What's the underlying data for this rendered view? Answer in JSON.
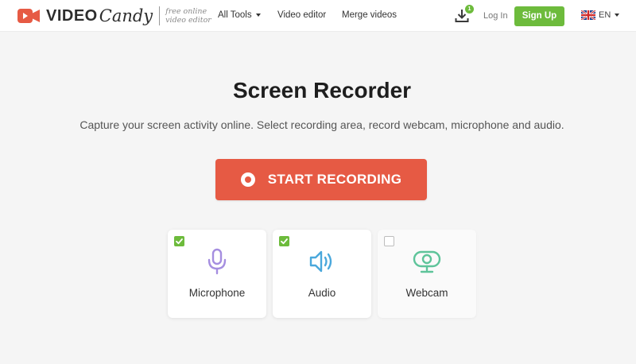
{
  "header": {
    "logo": {
      "word1": "VIDEO",
      "word2": "Candy",
      "tagline_line1": "free online",
      "tagline_line2": "video editor"
    },
    "nav": [
      {
        "label": "All Tools"
      },
      {
        "label": "Video editor"
      },
      {
        "label": "Merge videos"
      }
    ],
    "downloads_badge": "1",
    "login_label": "Log In",
    "signup_label": "Sign Up",
    "language": "EN"
  },
  "main": {
    "title": "Screen Recorder",
    "subtitle": "Capture your screen activity online. Select recording area, record webcam, microphone and audio.",
    "start_button": "START RECORDING"
  },
  "options": [
    {
      "label": "Microphone",
      "checked": true,
      "icon": "microphone-icon"
    },
    {
      "label": "Audio",
      "checked": true,
      "icon": "speaker-icon"
    },
    {
      "label": "Webcam",
      "checked": false,
      "icon": "webcam-icon"
    }
  ],
  "colors": {
    "brand": "#e65a44",
    "accent_green": "#6dbb3c",
    "microphone_icon": "#a58ee0",
    "speaker_icon": "#4aa8dc",
    "webcam_icon": "#5ec49a"
  }
}
